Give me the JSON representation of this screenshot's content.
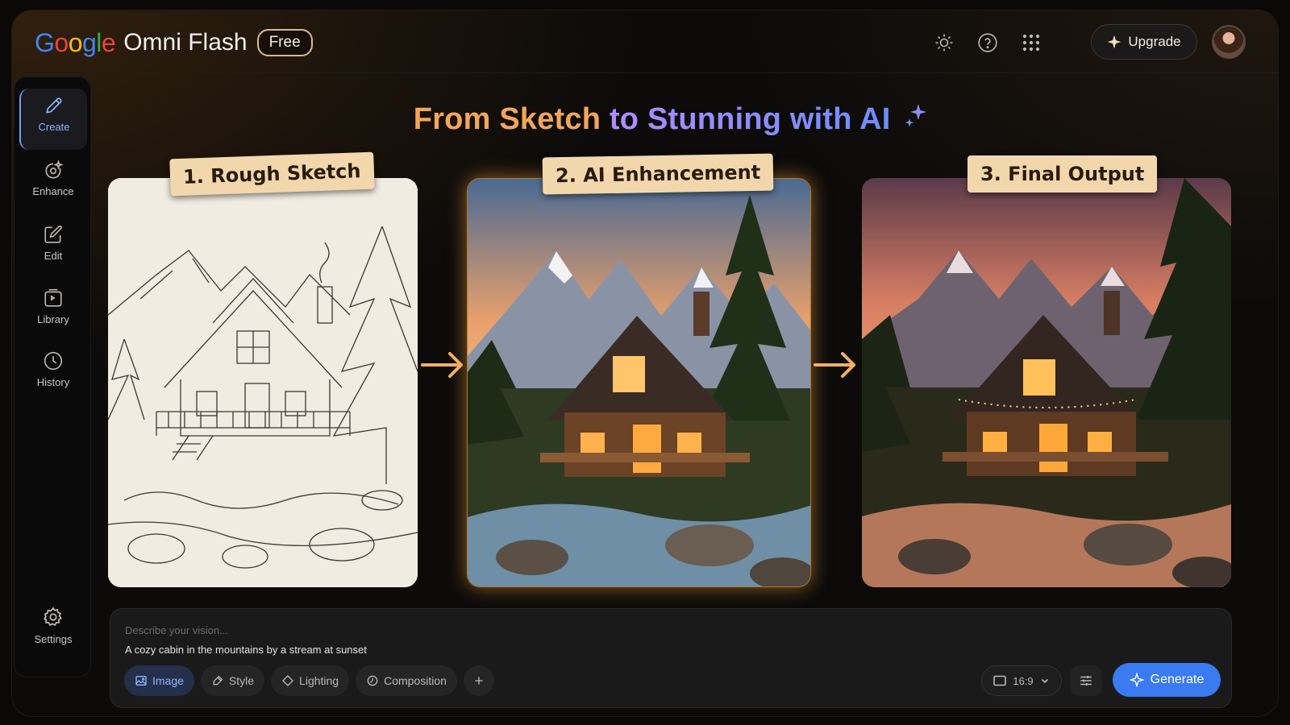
{
  "header": {
    "google_letters": [
      {
        "ch": "G",
        "color": "#4285F4"
      },
      {
        "ch": "o",
        "color": "#EA4335"
      },
      {
        "ch": "o",
        "color": "#FBBC05"
      },
      {
        "ch": "g",
        "color": "#4285F4"
      },
      {
        "ch": "l",
        "color": "#34A853"
      },
      {
        "ch": "e",
        "color": "#EA4335"
      }
    ],
    "product_name": "Omni Flash",
    "plan_badge": "Free",
    "icons": [
      "brightness-icon",
      "help-icon",
      "apps-grid-icon"
    ],
    "upgrade_label": "Upgrade"
  },
  "sidebar": {
    "items": [
      {
        "label": "Create",
        "icon": "pencil-icon",
        "active": true
      },
      {
        "label": "Enhance",
        "icon": "enhance-icon",
        "active": false
      },
      {
        "label": "Edit",
        "icon": "edit-icon",
        "active": false
      },
      {
        "label": "Library",
        "icon": "library-icon",
        "active": false
      },
      {
        "label": "History",
        "icon": "clock-icon",
        "active": false
      }
    ],
    "settings_label": "Settings"
  },
  "main": {
    "headline_part1": "From Sketch",
    "headline_part2": "to Stunning with AI",
    "steps": [
      {
        "label": "1. Rough Sketch"
      },
      {
        "label": "2. AI Enhancement"
      },
      {
        "label": "3. Final Output"
      }
    ]
  },
  "prompt": {
    "placeholder": "Describe your vision...",
    "value": "A cozy cabin in the mountains by a stream at sunset",
    "chips": [
      {
        "label": "Image",
        "icon": "image-icon",
        "active": true
      },
      {
        "label": "Style",
        "icon": "brush-icon",
        "active": false
      },
      {
        "label": "Lighting",
        "icon": "lighting-icon",
        "active": false
      },
      {
        "label": "Composition",
        "icon": "composition-icon",
        "active": false
      }
    ],
    "aspect_ratio": "16:9",
    "generate_label": "Generate"
  },
  "colors": {
    "accent": "#3b7bf2",
    "headline_orange": "#f3a65a",
    "headline_purple": "#8f8cff",
    "tag_bg": "#f2d7ad"
  }
}
